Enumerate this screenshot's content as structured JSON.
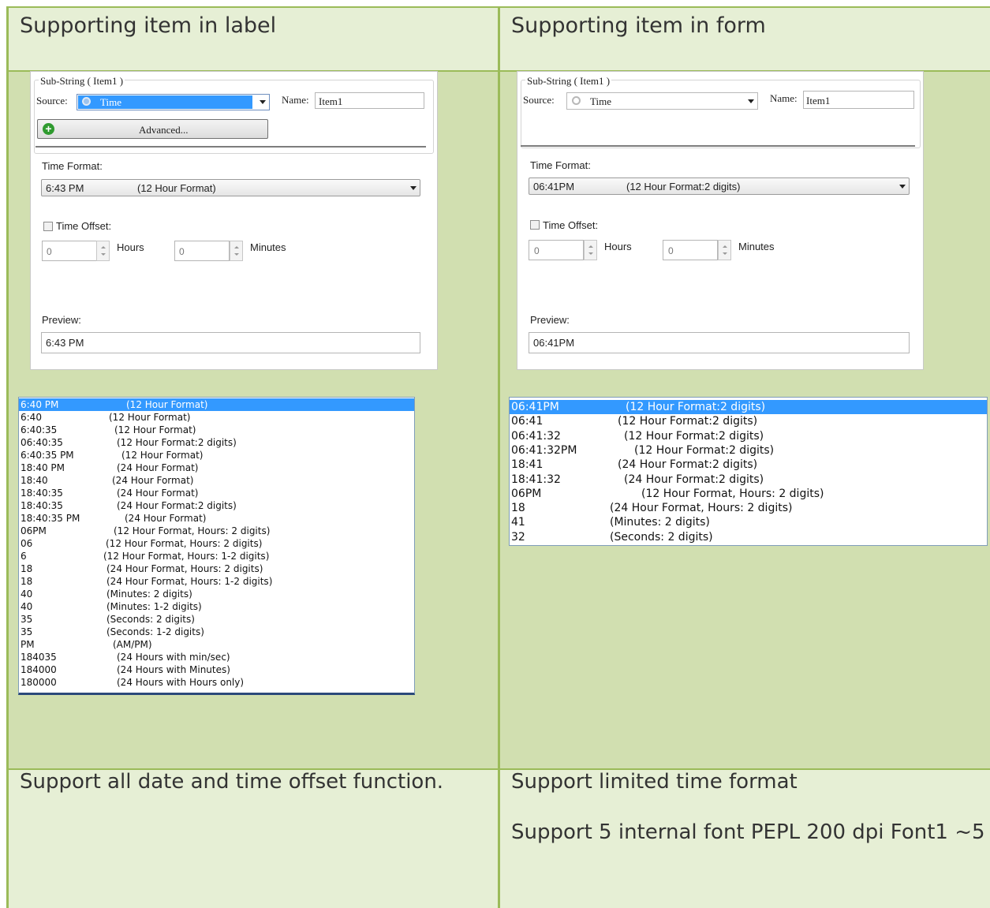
{
  "headers": {
    "left": "Supporting item in label",
    "right": "Supporting item in form"
  },
  "left_dialog": {
    "group_title": "Sub-String ( Item1 )",
    "source_label": "Source:",
    "source_value": "Time",
    "name_label": "Name:",
    "name_value": "Item1",
    "advanced_button": "Advanced...",
    "time_format_label": "Time Format:",
    "time_format_value": "6:43 PM",
    "time_format_desc": "(12 Hour Format)",
    "time_offset_label": "Time Offset:",
    "hours_value": "0",
    "hours_label": "Hours",
    "minutes_value": "0",
    "minutes_label": "Minutes",
    "preview_label": "Preview:",
    "preview_value": "6:43 PM"
  },
  "right_dialog": {
    "group_title": "Sub-String ( Item1 )",
    "source_label": "Source:",
    "source_value": "Time",
    "name_label": "Name:",
    "name_value": "Item1",
    "time_format_label": "Time Format:",
    "time_format_value": "06:41PM",
    "time_format_desc": "(12 Hour Format:2 digits)",
    "time_offset_label": "Time Offset:",
    "hours_value": "0",
    "hours_label": "Hours",
    "minutes_value": "0",
    "minutes_label": "Minutes",
    "preview_label": "Preview:",
    "preview_value": "06:41PM"
  },
  "left_list": [
    {
      "value": "6:40 PM",
      "desc": "(12 Hour Format)"
    },
    {
      "value": "6:40",
      "desc": "(12 Hour Format)"
    },
    {
      "value": "6:40:35",
      "desc": "(12 Hour Format)"
    },
    {
      "value": "06:40:35",
      "desc": "(12 Hour Format:2 digits)"
    },
    {
      "value": "6:40:35 PM",
      "desc": "(12 Hour Format)"
    },
    {
      "value": "18:40 PM",
      "desc": "(24 Hour Format)"
    },
    {
      "value": "18:40",
      "desc": "(24 Hour Format)"
    },
    {
      "value": "18:40:35",
      "desc": "(24 Hour Format)"
    },
    {
      "value": "18:40:35",
      "desc": "(24 Hour Format:2 digits)"
    },
    {
      "value": "18:40:35 PM",
      "desc": "(24 Hour Format)"
    },
    {
      "value": "06PM",
      "desc": "(12 Hour Format, Hours: 2 digits)"
    },
    {
      "value": "06",
      "desc": "(12 Hour Format, Hours: 2 digits)"
    },
    {
      "value": "6",
      "desc": "(12 Hour Format, Hours: 1-2 digits)"
    },
    {
      "value": "18",
      "desc": "(24 Hour Format, Hours: 2 digits)"
    },
    {
      "value": "18",
      "desc": "(24 Hour Format, Hours: 1-2 digits)"
    },
    {
      "value": "40",
      "desc": "(Minutes: 2 digits)"
    },
    {
      "value": "40",
      "desc": "(Minutes: 1-2 digits)"
    },
    {
      "value": "35",
      "desc": "(Seconds: 2 digits)"
    },
    {
      "value": "35",
      "desc": "(Seconds: 1-2 digits)"
    },
    {
      "value": "PM",
      "desc": "(AM/PM)"
    },
    {
      "value": "184035",
      "desc": "(24 Hours with min/sec)"
    },
    {
      "value": "184000",
      "desc": "(24 Hours with Minutes)"
    },
    {
      "value": "180000",
      "desc": "(24 Hours with Hours only)"
    }
  ],
  "right_list": [
    {
      "value": "06:41PM",
      "desc": "(12 Hour Format:2 digits)"
    },
    {
      "value": "06:41",
      "desc": "(12 Hour Format:2 digits)"
    },
    {
      "value": "06:41:32",
      "desc": "(12 Hour Format:2 digits)"
    },
    {
      "value": "06:41:32PM",
      "desc": "(12 Hour Format:2 digits)"
    },
    {
      "value": "18:41",
      "desc": "(24 Hour Format:2 digits)"
    },
    {
      "value": "18:41:32",
      "desc": "(24 Hour Format:2 digits)"
    },
    {
      "value": "06PM",
      "desc": "(12 Hour Format, Hours: 2 digits)"
    },
    {
      "value": "18",
      "desc": "(24 Hour Format, Hours: 2 digits)"
    },
    {
      "value": "41",
      "desc": "(Minutes: 2 digits)"
    },
    {
      "value": "32",
      "desc": "(Seconds: 2 digits)"
    }
  ],
  "footer": {
    "left": "Support all date and time offset function.",
    "right_line1": "Support limited time format",
    "right_line2": "Support 5 internal font  PEPL 200 dpi Font1 ~5"
  },
  "colors": {
    "header_bg": "#e6efd5",
    "body_bg": "#d1dfb0",
    "border": "#9bbb59",
    "selection": "#3399ff"
  }
}
